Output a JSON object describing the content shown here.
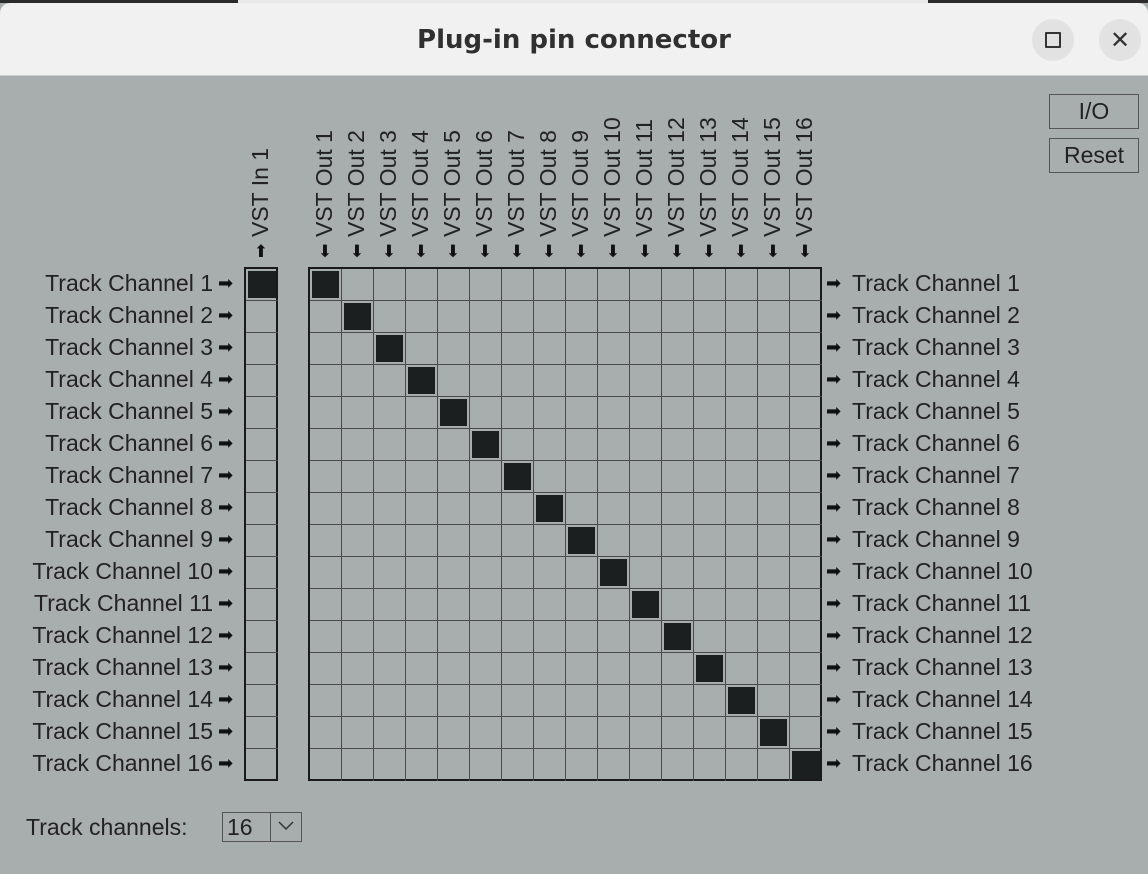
{
  "window": {
    "title": "Plug-in pin connector"
  },
  "buttons": {
    "io": "I/O",
    "reset": "Reset"
  },
  "input_pins": [
    "VST In 1"
  ],
  "output_pins": [
    "VST Out 1",
    "VST Out 2",
    "VST Out 3",
    "VST Out 4",
    "VST Out 5",
    "VST Out 6",
    "VST Out 7",
    "VST Out 8",
    "VST Out 9",
    "VST Out 10",
    "VST Out 11",
    "VST Out 12",
    "VST Out 13",
    "VST Out 14",
    "VST Out 15",
    "VST Out 16"
  ],
  "track_channels_left": [
    "Track Channel 1",
    "Track Channel 2",
    "Track Channel 3",
    "Track Channel 4",
    "Track Channel 5",
    "Track Channel 6",
    "Track Channel 7",
    "Track Channel 8",
    "Track Channel 9",
    "Track Channel 10",
    "Track Channel 11",
    "Track Channel 12",
    "Track Channel 13",
    "Track Channel 14",
    "Track Channel 15",
    "Track Channel 16"
  ],
  "track_channels_right": [
    "Track Channel 1",
    "Track Channel 2",
    "Track Channel 3",
    "Track Channel 4",
    "Track Channel 5",
    "Track Channel 6",
    "Track Channel 7",
    "Track Channel 8",
    "Track Channel 9",
    "Track Channel 10",
    "Track Channel 11",
    "Track Channel 12",
    "Track Channel 13",
    "Track Channel 14",
    "Track Channel 15",
    "Track Channel 16"
  ],
  "input_routing": [
    [
      true
    ],
    [
      false
    ],
    [
      false
    ],
    [
      false
    ],
    [
      false
    ],
    [
      false
    ],
    [
      false
    ],
    [
      false
    ],
    [
      false
    ],
    [
      false
    ],
    [
      false
    ],
    [
      false
    ],
    [
      false
    ],
    [
      false
    ],
    [
      false
    ],
    [
      false
    ]
  ],
  "output_routing_mode": "diagonal",
  "footer": {
    "track_channels_label": "Track channels:",
    "track_channels_value": "16"
  },
  "icons": {
    "arrow_right": "arrow-right-icon",
    "arrow_down": "arrow-down-icon",
    "arrow_up": "arrow-up-icon"
  },
  "colors": {
    "background": "#a8adad",
    "cell_on": "#1c1f20",
    "titlebar": "#f1f1f1"
  }
}
